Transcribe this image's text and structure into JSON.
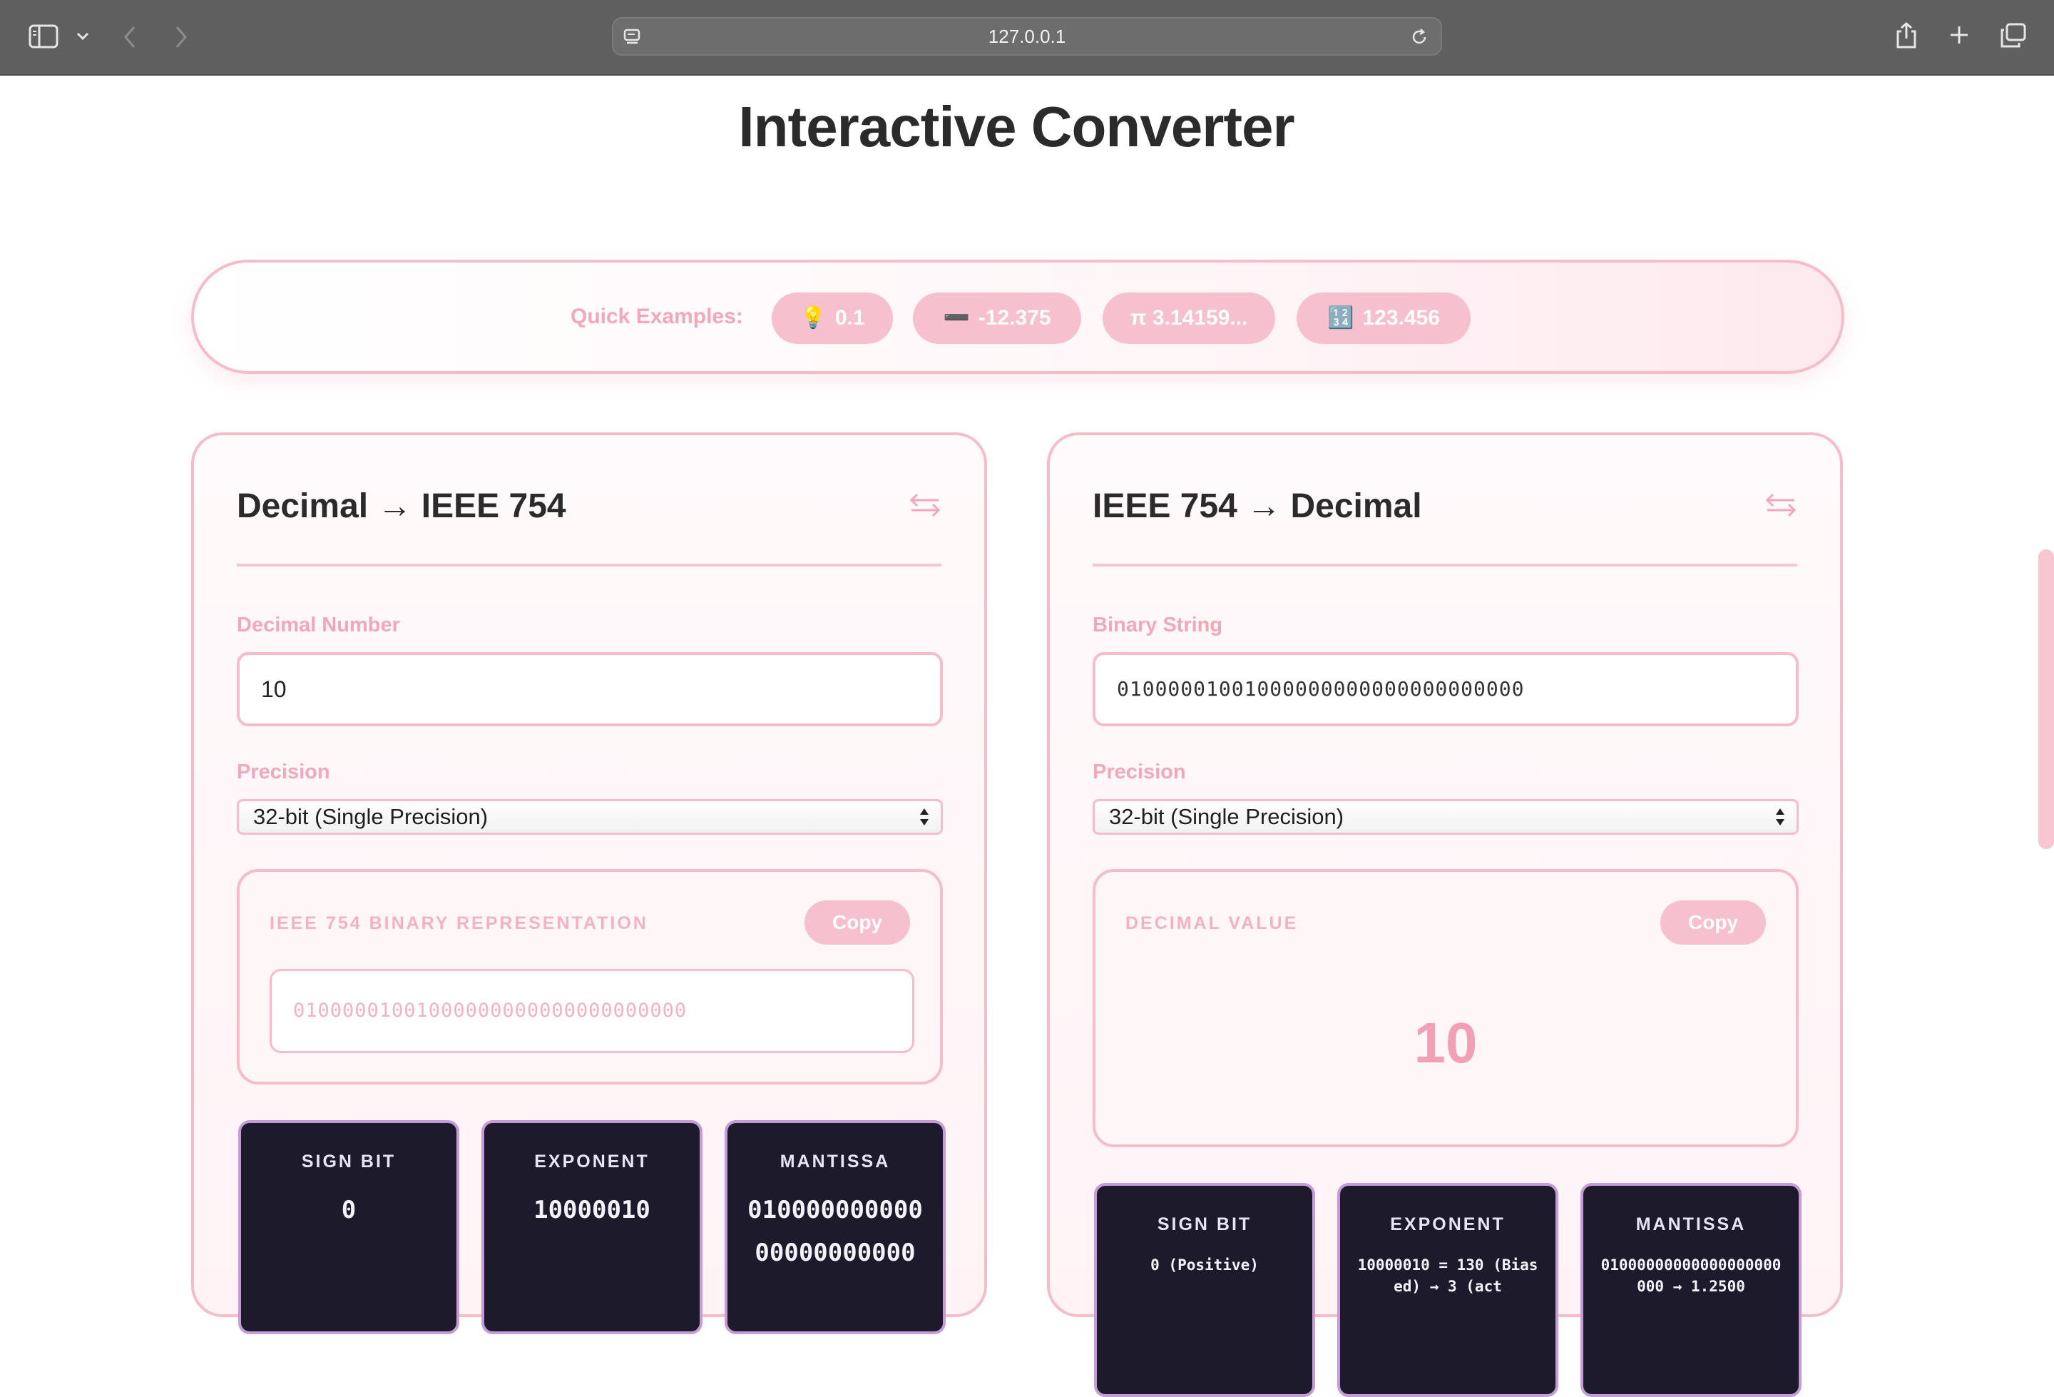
{
  "browser": {
    "url": "127.0.0.1"
  },
  "page": {
    "title": "Interactive Converter"
  },
  "quick_examples": {
    "label": "Quick Examples:",
    "chips": [
      {
        "icon": "💡",
        "label": "0.1"
      },
      {
        "icon": "➖",
        "label": "-12.375"
      },
      {
        "icon": "",
        "label": "π 3.14159..."
      },
      {
        "icon": "🔢",
        "label": "123.456"
      }
    ]
  },
  "decimal_to_ieee": {
    "title": "Decimal → IEEE 754",
    "input_label": "Decimal Number",
    "input_value": "10",
    "precision_label": "Precision",
    "precision_value": "32-bit (Single Precision)",
    "result_label": "IEEE 754 BINARY REPRESENTATION",
    "copy_label": "Copy",
    "result_value": "01000001001000000000000000000000",
    "sign": {
      "label": "SIGN BIT",
      "value": "0"
    },
    "exponent": {
      "label": "EXPONENT",
      "value": "10000010"
    },
    "mantissa": {
      "label": "MANTISSA",
      "value": "01000000000000000000000"
    }
  },
  "ieee_to_decimal": {
    "title": "IEEE 754 → Decimal",
    "input_label": "Binary String",
    "input_value": "01000001001000000000000000000000",
    "precision_label": "Precision",
    "precision_value": "32-bit (Single Precision)",
    "result_label": "DECIMAL VALUE",
    "copy_label": "Copy",
    "result_value": "10",
    "sign": {
      "label": "SIGN BIT",
      "value": "0 (Positive)"
    },
    "exponent": {
      "label": "EXPONENT",
      "value": "10000010 = 130 (Biased) → 3 (act"
    },
    "mantissa": {
      "label": "MANTISSA",
      "value": "01000000000000000000000 → 1.2500"
    }
  },
  "colors": {
    "accent_pink": "#f7c0ce",
    "border_pink": "#f6bcc9",
    "label_pink": "#f3a7ba",
    "bit_box_bg": "#1c1a2b",
    "bit_box_border": "#c69bd8"
  }
}
